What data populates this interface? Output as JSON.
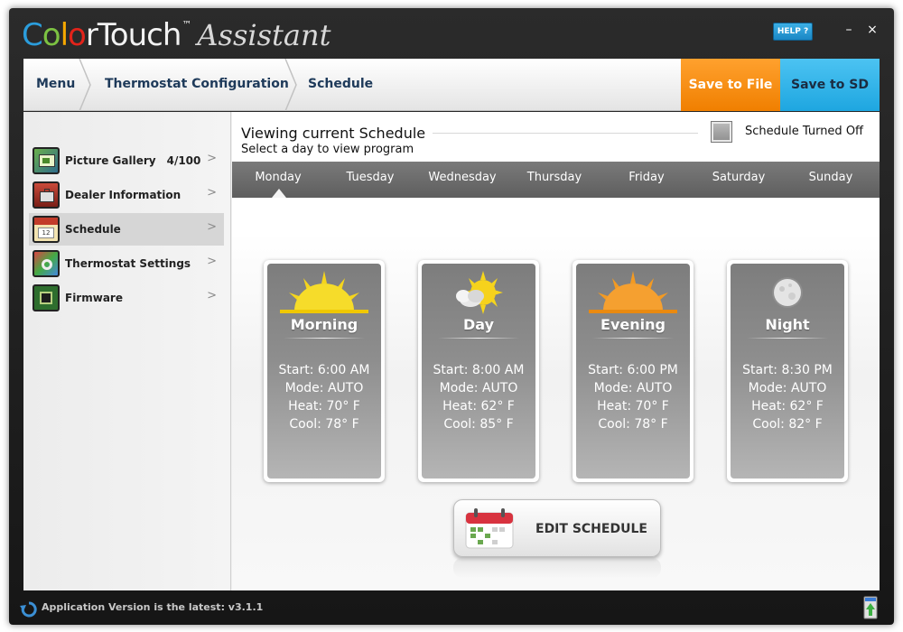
{
  "app": {
    "brand": "ColorTouch",
    "trademark": "™",
    "subtitle": "Assistant",
    "help_label": "HELP ?",
    "minimize_label": "–",
    "close_label": "×"
  },
  "nav": {
    "breadcrumbs": [
      "Menu",
      "Thermostat Configuration",
      "Schedule"
    ],
    "save_file_label": "Save to File",
    "save_sd_label": "Save to SD",
    "save_file_color": "#f58a0b",
    "save_sd_color": "#35b5ea"
  },
  "sidebar": {
    "items": [
      {
        "label": "Picture Gallery",
        "count": "4/100",
        "chevron": ">",
        "icon": "picture-gallery-icon"
      },
      {
        "label": "Dealer Information",
        "chevron": ">",
        "icon": "dealer-info-icon"
      },
      {
        "label": "Schedule",
        "chevron": ">",
        "icon": "schedule-calendar-icon",
        "active": true
      },
      {
        "label": "Thermostat Settings",
        "chevron": ">",
        "icon": "thermostat-settings-icon"
      },
      {
        "label": "Firmware",
        "chevron": ">",
        "icon": "firmware-chip-icon"
      }
    ]
  },
  "schedule": {
    "title": "Viewing current Schedule",
    "subtitle": "Select a day to view program",
    "toggle_label": "Schedule Turned Off",
    "days": [
      "Monday",
      "Tuesday",
      "Wednesday",
      "Thursday",
      "Friday",
      "Saturday",
      "Sunday"
    ],
    "selected_day": "Monday",
    "periods": [
      {
        "name": "Morning",
        "icon": "sunrise-icon",
        "start": "Start: 6:00 AM",
        "mode": "Mode: AUTO",
        "heat": "Heat: 70° F",
        "cool": "Cool: 78° F"
      },
      {
        "name": "Day",
        "icon": "sun-cloud-icon",
        "start": "Start: 8:00 AM",
        "mode": "Mode: AUTO",
        "heat": "Heat: 62° F",
        "cool": "Cool: 85° F"
      },
      {
        "name": "Evening",
        "icon": "sunset-icon",
        "start": "Start: 6:00 PM",
        "mode": "Mode: AUTO",
        "heat": "Heat: 70° F",
        "cool": "Cool: 78° F"
      },
      {
        "name": "Night",
        "icon": "moon-icon",
        "start": "Start: 8:30 PM",
        "mode": "Mode: AUTO",
        "heat": "Heat: 62° F",
        "cool": "Cool: 82° F"
      }
    ],
    "edit_label": "EDIT SCHEDULE"
  },
  "status": {
    "version_text": "Application Version is the latest: v3.1.1"
  }
}
